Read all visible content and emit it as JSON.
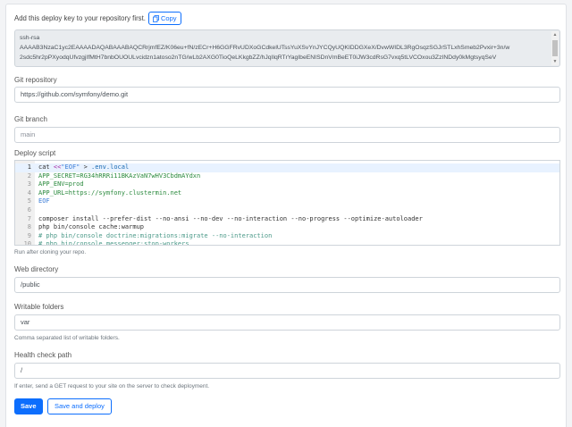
{
  "deploy_key": {
    "intro": "Add this deploy key to your repository first.",
    "copy_label": "Copy",
    "key_lines": [
      "ssh-rsa",
      "AAAAB3NzaC1yc2EAAAADAQABAAABAQCRrjmfEZ/K06eu+fN/zECr+H6GGFRvUDXoGCdkelUTssYuXSvYnJYCQyUQKIDDGXeX/DvwWIDL3RgOsqzSGJrSTLxhSmeb2Pvxir+3n/w",
      "2sdc5hr2pPXyodqUfvzgjIfMtH7bnbOUOULvcidzn1atoso2nTG/wLb2AXG0TioQeLKkgbZZ/hJqIlqRTrYagIbeENISDnVmBeET0iJW3cdRsG7vxq5tLVCOxou3ZzINDdy0kMgtsyqSeV"
    ]
  },
  "git_repository": {
    "label": "Git repository",
    "value": "https://github.com/symfony/demo.git"
  },
  "git_branch": {
    "label": "Git branch",
    "placeholder": "main"
  },
  "deploy_script": {
    "label": "Deploy script",
    "help": "Run after cloning your repo.",
    "lines": [
      {
        "num": "1",
        "segments": [
          {
            "t": "cat ",
            "c": "def"
          },
          {
            "t": "<<",
            "c": "op"
          },
          {
            "t": "\"EOF\"",
            "c": "eof"
          },
          {
            "t": " > ",
            "c": "def"
          },
          {
            "t": ".env.local",
            "c": "key"
          }
        ]
      },
      {
        "num": "2",
        "segments": [
          {
            "t": "APP_SECRET=RG34hRRRi11BKAzVaN7wHV3CbdmAYdxn",
            "c": "str"
          }
        ]
      },
      {
        "num": "3",
        "segments": [
          {
            "t": "APP_ENV=prod",
            "c": "str"
          }
        ]
      },
      {
        "num": "4",
        "segments": [
          {
            "t": "APP_URL=https://symfony.clustermin.net",
            "c": "str"
          }
        ]
      },
      {
        "num": "5",
        "segments": [
          {
            "t": "EOF",
            "c": "eof"
          }
        ]
      },
      {
        "num": "6",
        "segments": []
      },
      {
        "num": "7",
        "segments": [
          {
            "t": "composer install --prefer-dist --no-ansi --no-dev --no-interaction --no-progress --optimize-autoloader",
            "c": "def"
          }
        ]
      },
      {
        "num": "8",
        "segments": [
          {
            "t": "php bin/console cache:warmup",
            "c": "def"
          }
        ]
      },
      {
        "num": "9",
        "segments": [
          {
            "t": "# php bin/console doctrine:migrations:migrate --no-interaction",
            "c": "com"
          }
        ]
      },
      {
        "num": "10",
        "segments": [
          {
            "t": "# php bin/console messenger:stop-workers",
            "c": "com"
          }
        ]
      }
    ]
  },
  "web_directory": {
    "label": "Web directory",
    "value": "/public"
  },
  "writable_folders": {
    "label": "Writable folders",
    "value": "var",
    "help": "Comma separated list of writable folders."
  },
  "health_check": {
    "label": "Health check path",
    "value": "/",
    "help": "If enter, send a GET request to your site on the server to check deployment."
  },
  "actions": {
    "save_label": "Save",
    "save_deploy_label": "Save and deploy"
  },
  "colors": {
    "primary": "#0d6efd",
    "readonly_bg": "#e9ecef",
    "border": "#ced4da"
  }
}
